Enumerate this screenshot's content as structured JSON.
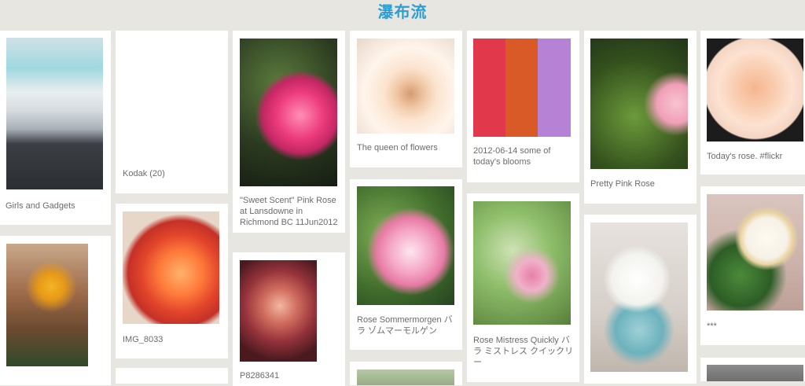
{
  "header": {
    "title": "瀑布流"
  },
  "cards": {
    "gadgets": {
      "caption": "Girls and Gadgets",
      "image_icon": "laptop-phone-photo-icon"
    },
    "kodak": {
      "caption": "Kodak (20)"
    },
    "sweet_scent": {
      "caption": "\"Sweet Scent\" Pink Rose at Lansdowne in Richmond BC 11Jun2012",
      "image_icon": "pink-rose-photo-icon"
    },
    "queen": {
      "caption": "The queen of flowers",
      "image_icon": "peach-rose-photo-icon"
    },
    "blooms": {
      "caption": "2012-06-14 some of today's blooms",
      "image_icon": "flower-collage-photo-icon"
    },
    "pretty_pink": {
      "caption": "Pretty Pink Rose",
      "image_icon": "pink-rose-leaves-photo-icon"
    },
    "todays_rose": {
      "caption": "Today's rose. #flickr",
      "image_icon": "peach-rose-framed-photo-icon"
    },
    "festival": {
      "caption": "",
      "image_icon": "festival-costume-photo-icon"
    },
    "img8033": {
      "caption": "IMG_8033",
      "image_icon": "orange-rose-photo-icon"
    },
    "dark_rose": {
      "caption": "P8286341",
      "image_icon": "dark-red-rose-photo-icon"
    },
    "sommermorgen": {
      "caption": "Rose Sommermorgen バラ ゾムマーモルゲン",
      "image_icon": "wild-pink-rose-photo-icon"
    },
    "mistress": {
      "caption": "Rose Mistress Quickly バラ ミストレス クイックリー",
      "image_icon": "pink-cluster-rose-photo-icon"
    },
    "cake": {
      "caption": "",
      "image_icon": "rose-cupcake-photo-icon"
    },
    "white_rose": {
      "caption": "***",
      "image_icon": "white-rose-photo-icon"
    }
  }
}
